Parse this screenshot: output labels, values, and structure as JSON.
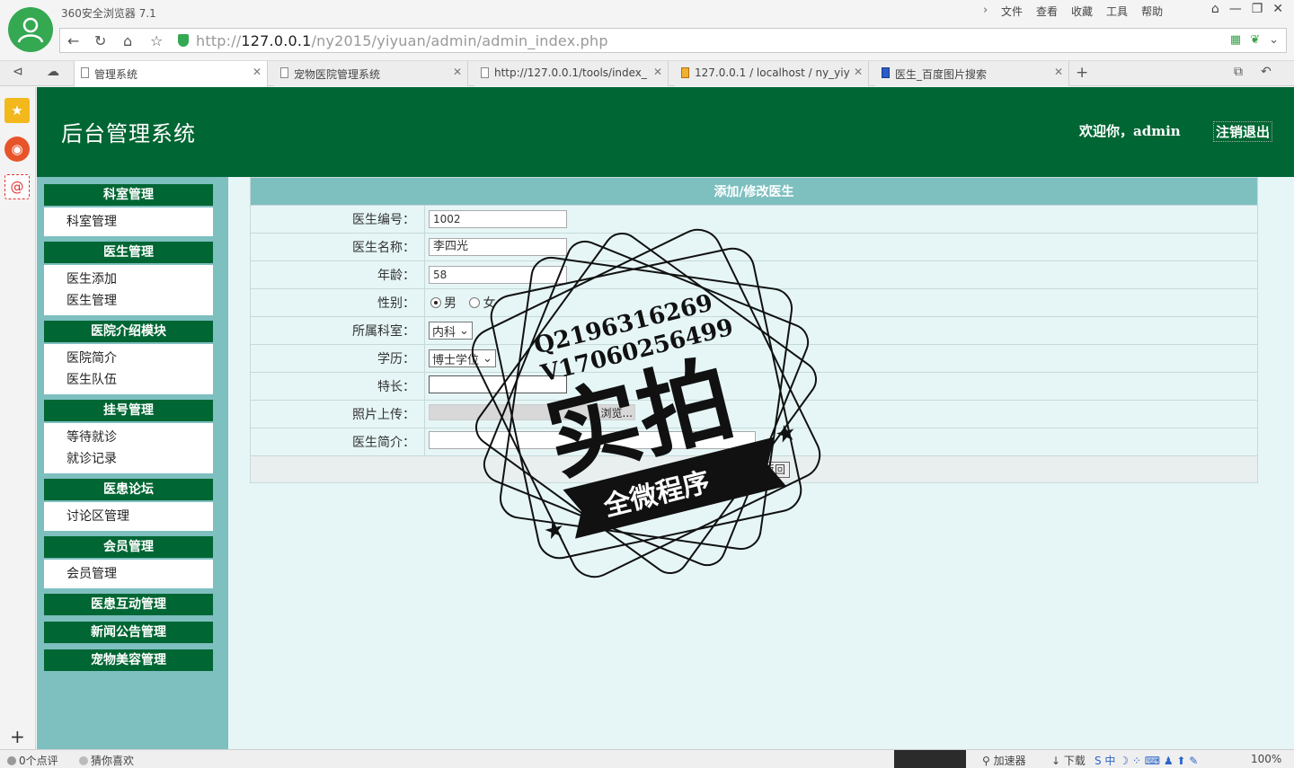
{
  "browser": {
    "title": "360安全浏览器 7.1",
    "menu": [
      "文件",
      "查看",
      "收藏",
      "工具",
      "帮助"
    ],
    "url_scheme": "http://",
    "url_host": "127.0.0.1",
    "url_path": "/ny2015/yiyuan/admin/admin_index.php",
    "tabs": [
      "管理系统",
      "宠物医院管理系统",
      "http://127.0.0.1/tools/index_",
      "127.0.0.1 / localhost / ny_yiy",
      "医生_百度图片搜索"
    ]
  },
  "header": {
    "title": "后台管理系统",
    "welcome": "欢迎你，admin",
    "logout": "注销退出"
  },
  "sidebar": {
    "sections": [
      {
        "title": "科室管理",
        "items": [
          "科室管理"
        ]
      },
      {
        "title": "医生管理",
        "items": [
          "医生添加",
          "医生管理"
        ]
      },
      {
        "title": "医院介绍模块",
        "items": [
          "医院简介",
          "医生队伍"
        ]
      },
      {
        "title": "挂号管理",
        "items": [
          "等待就诊",
          "就诊记录"
        ]
      },
      {
        "title": "医患论坛",
        "items": [
          "讨论区管理"
        ]
      },
      {
        "title": "会员管理",
        "items": [
          "会员管理"
        ]
      },
      {
        "title": "医患互动管理",
        "items": []
      },
      {
        "title": "新闻公告管理",
        "items": []
      },
      {
        "title": "宠物美容管理",
        "items": []
      }
    ]
  },
  "form": {
    "title": "添加/修改医生",
    "fields": {
      "id": {
        "label": "医生编号：",
        "value": "1002"
      },
      "name": {
        "label": "医生名称：",
        "value": "李四光"
      },
      "age": {
        "label": "年龄：",
        "value": "58"
      },
      "gender": {
        "label": "性别：",
        "male": "男",
        "female": "女"
      },
      "dept": {
        "label": "所属科室：",
        "value": "内科"
      },
      "degree": {
        "label": "学历：",
        "value": "博士学位"
      },
      "specialty": {
        "label": "特长：",
        "value": ""
      },
      "photo": {
        "label": "照片上传：",
        "browse": "浏览..."
      },
      "intro": {
        "label": "医生简介：",
        "value": ""
      }
    },
    "submit_label": "返回"
  },
  "watermark": {
    "line1": "Q2196316269",
    "line2": "V17060256499",
    "big": "实拍",
    "ribbon": "全微程序"
  },
  "statusbar": {
    "comments": "0个点评",
    "guess": "猜你喜欢",
    "accelerator": "加速器",
    "download": "下载",
    "zoom": "100%"
  },
  "colors": {
    "header_green": "#006633",
    "sidebar_teal": "#7ebfc0",
    "content_bg": "#e6f6f6"
  }
}
